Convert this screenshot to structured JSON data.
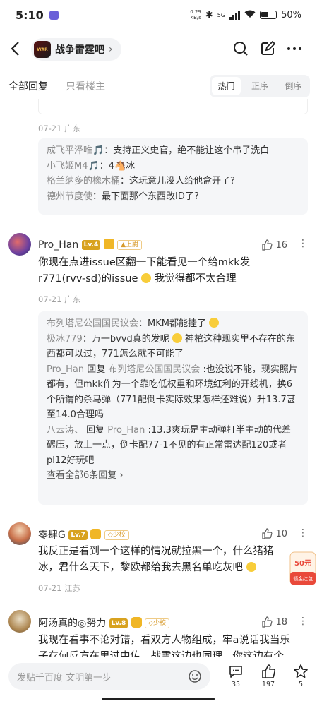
{
  "status": {
    "time": "5:10",
    "net_speed": "0.29",
    "net_unit": "KB/s",
    "signal": "5G",
    "battery": "50%"
  },
  "nav": {
    "forum_name": "战争雷霆吧"
  },
  "tabs": {
    "all": "全部回复",
    "op_only": "只看楼主",
    "sort": [
      "热门",
      "正序",
      "倒序"
    ],
    "active_sort": "热门"
  },
  "prev_meta": "07-21 广东",
  "prev_replies": [
    {
      "user": "成飞平泽唯🎵",
      "text": "支持正义史官，绝不能让这个串子洗白"
    },
    {
      "user": "小飞姬M4🎵",
      "text": "4🐴冰"
    },
    {
      "user": "格兰纳多的橡木桶",
      "text": "这玩意儿没人给他盒开了?"
    },
    {
      "user": "德州节度使",
      "text": "最下面那个东西改ID了?"
    }
  ],
  "comments": [
    {
      "user": "Pro_Han",
      "level": "Lv.4",
      "tag": "▲上尉",
      "likes": "16",
      "text_lines": [
        "你现在点进issue区翻一下能看见一个给mkk发",
        "r771(rvv-sd)的issue",
        " 我觉得都不太合理"
      ],
      "meta": "07-21 广东",
      "replies": [
        {
          "user": "布列塔尼公国国民议会",
          "sep": "：",
          "text": "MKM都能挂了"
        },
        {
          "user": "极冰779",
          "sep": "：",
          "text": "万一bvvd真的发呢",
          "text2": " 神棺这种现实里不存在的东西都可以过，771怎么就不可能了"
        },
        {
          "user": "Pro_Han",
          "reply_word": " 回复 ",
          "target": "布列塔尼公国国民议会",
          "sep": " :",
          "text": "也没说不能，现实照片都有，但mkk作为一个靠吃低权重和环境红利的开线机，换6个所谓的杀马弹（771配倒卡实际效果怎样还难说）升13.7甚至14.0合理吗"
        },
        {
          "user": "八云涛、",
          "reply_word": " 回复 ",
          "target": "Pro_Han",
          "sep": " :",
          "text": "13.3爽玩是主动弹打半主动的代差碾压，放上一点，倒卡配77-1不见的有正常雷达配120或者pl12好玩吧"
        }
      ],
      "more": "查看全部6条回复"
    },
    {
      "user": "零肆G",
      "level": "Lv.7",
      "tag": "◇少校",
      "likes": "10",
      "text_lines": [
        "我反正是看到一个这样的情况就拉黑一个，什么猪猪",
        "冰，君什么天下，黎欧都给我去黑名单吃灰吧"
      ],
      "meta": "07-21 江苏"
    },
    {
      "user": "阿汤真的◎努力",
      "level": "Lv.8",
      "tag": "◇少校",
      "likes": "18",
      "text_lines": [
        "我现在看事不论对错，看双方人物组成，牢a说话我当乐",
        "子存何反方在里过中传，战雪这边也同理，你这边有个"
      ]
    }
  ],
  "hongbao": {
    "amount": "50元",
    "label": "领金红包"
  },
  "bottom": {
    "placeholder": "发贴千百度 文明第一步",
    "comments": "35",
    "likes": "197",
    "stars": "5"
  },
  "colors": {
    "level_badge": "#d8a21f",
    "vip": "#f0b626",
    "reply_bg": "#f5f6f8"
  }
}
